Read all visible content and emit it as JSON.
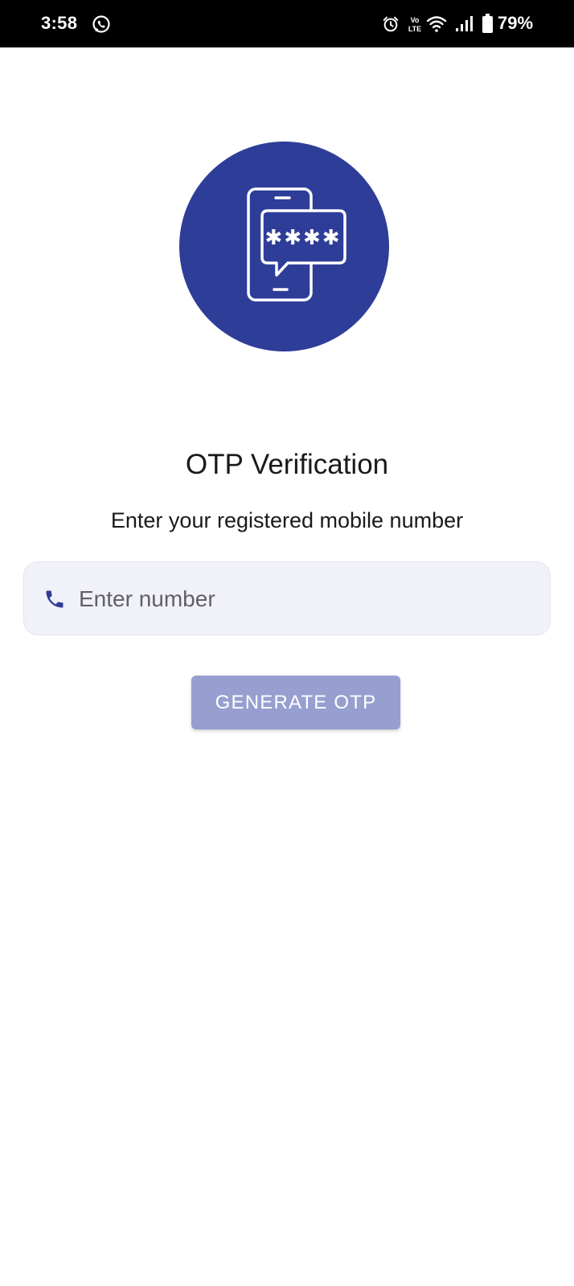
{
  "status_bar": {
    "time": "3:58",
    "battery_percent": "79%",
    "icons": [
      "whatsapp-icon",
      "alarm-icon",
      "volte-icon",
      "wifi-icon",
      "signal-icon",
      "battery-icon"
    ]
  },
  "hero": {
    "icon": "otp-phone-message-icon",
    "background_color": "#2e3d98"
  },
  "title": "OTP Verification",
  "subtitle": "Enter your registered mobile number",
  "phone_input": {
    "icon": "phone-icon",
    "placeholder": "Enter number",
    "value": ""
  },
  "generate_button": {
    "label": "GENERATE OTP",
    "color": "#979fd0"
  },
  "colors": {
    "accent": "#2e3d98",
    "input_background": "#f0f1f9"
  }
}
